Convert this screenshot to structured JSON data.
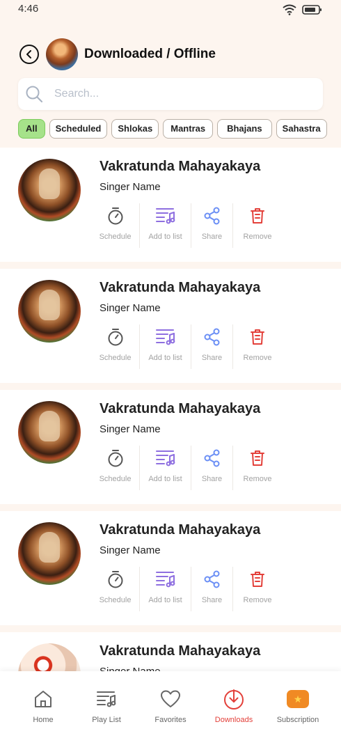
{
  "status_bar": {
    "time": "4:46"
  },
  "header": {
    "title": "Downloaded / Offline"
  },
  "search": {
    "placeholder": "Search..."
  },
  "filters": {
    "chips": [
      {
        "label": "All",
        "active": true
      },
      {
        "label": "Scheduled",
        "active": false
      },
      {
        "label": "Shlokas",
        "active": false
      },
      {
        "label": "Mantras",
        "active": false
      },
      {
        "label": "Bhajans",
        "active": false
      },
      {
        "label": "Sahastra",
        "active": false
      }
    ]
  },
  "actions": {
    "schedule": "Schedule",
    "add_to_list": "Add to list",
    "share": "Share",
    "remove": "Remove"
  },
  "songs": [
    {
      "title": "Vakratunda Mahayakaya",
      "singer": "Singer Name"
    },
    {
      "title": "Vakratunda Mahayakaya",
      "singer": "Singer Name"
    },
    {
      "title": "Vakratunda Mahayakaya",
      "singer": "Singer Name"
    },
    {
      "title": "Vakratunda Mahayakaya",
      "singer": "Singer Name"
    },
    {
      "title": "Vakratunda Mahayakaya",
      "singer": "Singer Name"
    }
  ],
  "bottom_nav": {
    "home": "Home",
    "playlist": "Play List",
    "favorites": "Favorites",
    "downloads": "Downloads",
    "subscription": "Subscription"
  },
  "colors": {
    "background": "#fdf5ef",
    "active_chip": "#a6e28a",
    "playlist_icon": "#8e6fe0",
    "share_icon": "#6b8ff5",
    "remove_icon": "#e3403a",
    "nav_active": "#e3403a"
  }
}
